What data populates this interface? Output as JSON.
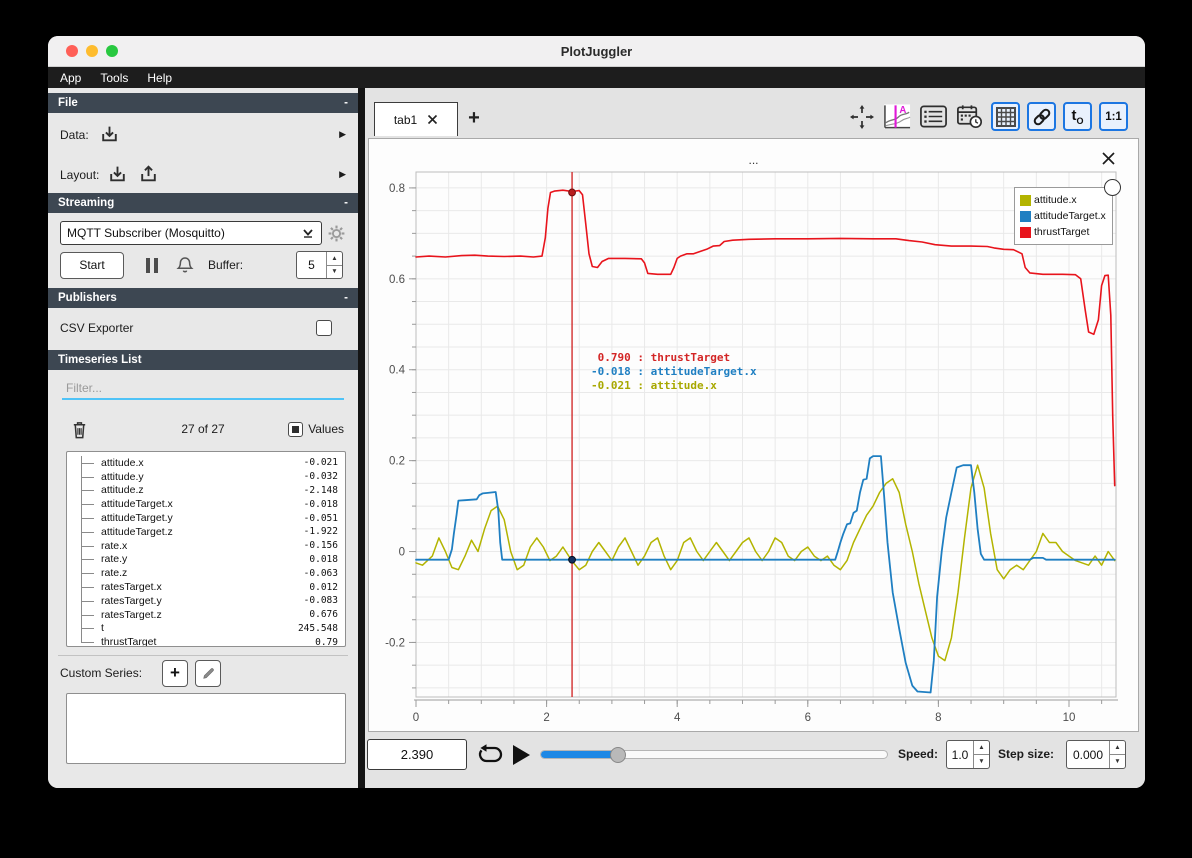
{
  "window": {
    "title": "PlotJuggler"
  },
  "menu": {
    "items": [
      "App",
      "Tools",
      "Help"
    ]
  },
  "sidebar": {
    "file": {
      "header": "File",
      "collapse": "-",
      "data_label": "Data:",
      "layout_label": "Layout:"
    },
    "streaming": {
      "header": "Streaming",
      "collapse": "-",
      "source": "MQTT Subscriber (Mosquitto)",
      "start_label": "Start",
      "buffer_label": "Buffer:",
      "buffer_value": "5"
    },
    "publishers": {
      "header": "Publishers",
      "collapse": "-",
      "csv_label": "CSV Exporter",
      "csv_checked": false
    },
    "timeseries": {
      "header": "Timeseries List",
      "filter_placeholder": "Filter...",
      "count": "27 of 27",
      "values_label": "Values",
      "values_checked": true,
      "items": [
        {
          "name": "attitude.x",
          "value": "-0.021"
        },
        {
          "name": "attitude.y",
          "value": "-0.032"
        },
        {
          "name": "attitude.z",
          "value": "-2.148"
        },
        {
          "name": "attitudeTarget.x",
          "value": "-0.018"
        },
        {
          "name": "attitudeTarget.y",
          "value": "-0.051"
        },
        {
          "name": "attitudeTarget.z",
          "value": "-1.922"
        },
        {
          "name": "rate.x",
          "value": "-0.156"
        },
        {
          "name": "rate.y",
          "value": "0.018"
        },
        {
          "name": "rate.z",
          "value": "-0.063"
        },
        {
          "name": "ratesTarget.x",
          "value": "0.012"
        },
        {
          "name": "ratesTarget.y",
          "value": "-0.083"
        },
        {
          "name": "ratesTarget.z",
          "value": "0.676"
        },
        {
          "name": "t",
          "value": "245.548"
        },
        {
          "name": "thrustTarget",
          "value": "0.79"
        }
      ],
      "custom_series_label": "Custom Series:"
    }
  },
  "main": {
    "tab_label": "tab1",
    "plot_title": "..."
  },
  "transport": {
    "time": "2.390",
    "slider_percent": 22.3,
    "speed_label": "Speed:",
    "speed": "1.0",
    "step_label": "Step size:",
    "step": "0.000"
  },
  "colors": {
    "accent_blue": "#1c76e2",
    "slider_blue": "#1e88e5",
    "filter_underline": "#4fc3f7",
    "header_bg": "#3d4752"
  },
  "chart_data": {
    "type": "line",
    "title": "...",
    "xlabel": "",
    "ylabel": "",
    "xlim": [
      0,
      10.72
    ],
    "ylim": [
      -0.32,
      0.835
    ],
    "x_ticks": [
      0,
      2,
      4,
      6,
      8,
      10
    ],
    "y_ticks": [
      -0.2,
      0,
      0.2,
      0.4,
      0.6,
      0.8
    ],
    "grid": {
      "on": true,
      "x_minor": 0.5,
      "y_minor": 0.05
    },
    "legend_position": "top-right",
    "series": [
      {
        "name": "attitude.x",
        "color": "#b3b400",
        "width": 1.5,
        "points": [
          [
            0,
            -0.025
          ],
          [
            0.1,
            -0.03
          ],
          [
            0.25,
            -0.01
          ],
          [
            0.35,
            0.03
          ],
          [
            0.45,
            0.0
          ],
          [
            0.55,
            -0.035
          ],
          [
            0.65,
            -0.04
          ],
          [
            0.75,
            -0.01
          ],
          [
            0.85,
            0.025
          ],
          [
            0.95,
            0.0
          ],
          [
            1.05,
            0.05
          ],
          [
            1.15,
            0.09
          ],
          [
            1.25,
            0.1
          ],
          [
            1.35,
            0.07
          ],
          [
            1.45,
            0.0
          ],
          [
            1.55,
            -0.04
          ],
          [
            1.65,
            -0.03
          ],
          [
            1.75,
            0.01
          ],
          [
            1.85,
            0.03
          ],
          [
            1.95,
            0.01
          ],
          [
            2.05,
            -0.02
          ],
          [
            2.15,
            -0.01
          ],
          [
            2.25,
            0.01
          ],
          [
            2.39,
            -0.021
          ],
          [
            2.5,
            -0.04
          ],
          [
            2.6,
            -0.03
          ],
          [
            2.7,
            0.0
          ],
          [
            2.8,
            0.02
          ],
          [
            2.9,
            0.0
          ],
          [
            3.0,
            -0.02
          ],
          [
            3.1,
            0.01
          ],
          [
            3.2,
            0.03
          ],
          [
            3.3,
            0.0
          ],
          [
            3.4,
            -0.03
          ],
          [
            3.5,
            -0.01
          ],
          [
            3.6,
            0.02
          ],
          [
            3.7,
            0.03
          ],
          [
            3.8,
            -0.01
          ],
          [
            3.9,
            -0.04
          ],
          [
            4.0,
            -0.02
          ],
          [
            4.1,
            0.02
          ],
          [
            4.2,
            0.03
          ],
          [
            4.3,
            0.0
          ],
          [
            4.4,
            -0.02
          ],
          [
            4.5,
            0.0
          ],
          [
            4.6,
            0.02
          ],
          [
            4.7,
            0.0
          ],
          [
            4.8,
            -0.02
          ],
          [
            4.9,
            0.0
          ],
          [
            5.0,
            0.02
          ],
          [
            5.1,
            0.03
          ],
          [
            5.2,
            0.0
          ],
          [
            5.3,
            -0.02
          ],
          [
            5.4,
            0.0
          ],
          [
            5.5,
            0.03
          ],
          [
            5.6,
            0.02
          ],
          [
            5.7,
            -0.01
          ],
          [
            5.8,
            -0.02
          ],
          [
            5.9,
            0.0
          ],
          [
            6.0,
            0.01
          ],
          [
            6.1,
            -0.01
          ],
          [
            6.2,
            -0.02
          ],
          [
            6.3,
            -0.01
          ],
          [
            6.4,
            -0.03
          ],
          [
            6.5,
            -0.04
          ],
          [
            6.6,
            -0.02
          ],
          [
            6.7,
            0.02
          ],
          [
            6.8,
            0.05
          ],
          [
            6.9,
            0.08
          ],
          [
            7.0,
            0.1
          ],
          [
            7.1,
            0.13
          ],
          [
            7.2,
            0.15
          ],
          [
            7.3,
            0.16
          ],
          [
            7.4,
            0.13
          ],
          [
            7.5,
            0.06
          ],
          [
            7.6,
            0.0
          ],
          [
            7.7,
            -0.07
          ],
          [
            7.8,
            -0.13
          ],
          [
            7.9,
            -0.19
          ],
          [
            8.0,
            -0.23
          ],
          [
            8.1,
            -0.24
          ],
          [
            8.2,
            -0.19
          ],
          [
            8.3,
            -0.09
          ],
          [
            8.4,
            0.03
          ],
          [
            8.5,
            0.14
          ],
          [
            8.6,
            0.19
          ],
          [
            8.7,
            0.14
          ],
          [
            8.8,
            0.04
          ],
          [
            8.9,
            -0.04
          ],
          [
            9.0,
            -0.06
          ],
          [
            9.1,
            -0.04
          ],
          [
            9.2,
            -0.03
          ],
          [
            9.3,
            -0.04
          ],
          [
            9.5,
            0.0
          ],
          [
            9.6,
            0.04
          ],
          [
            9.7,
            0.02
          ],
          [
            9.8,
            0.02
          ],
          [
            9.9,
            0.0
          ],
          [
            10.0,
            -0.01
          ],
          [
            10.1,
            -0.02
          ],
          [
            10.3,
            -0.03
          ],
          [
            10.4,
            -0.01
          ],
          [
            10.5,
            -0.03
          ],
          [
            10.6,
            0.0
          ],
          [
            10.7,
            -0.02
          ]
        ]
      },
      {
        "name": "attitudeTarget.x",
        "color": "#1f7fc2",
        "width": 1.8,
        "points": [
          [
            0,
            -0.018
          ],
          [
            0.5,
            -0.018
          ],
          [
            0.55,
            0.005
          ],
          [
            0.58,
            0.04
          ],
          [
            0.62,
            0.08
          ],
          [
            0.65,
            0.112
          ],
          [
            0.75,
            0.113
          ],
          [
            0.93,
            0.115
          ],
          [
            0.97,
            0.124
          ],
          [
            1.02,
            0.128
          ],
          [
            1.1,
            0.129
          ],
          [
            1.22,
            0.131
          ],
          [
            1.26,
            0.09
          ],
          [
            1.29,
            0.02
          ],
          [
            1.32,
            -0.018
          ],
          [
            2.0,
            -0.018
          ],
          [
            2.39,
            -0.018
          ],
          [
            3.0,
            -0.018
          ],
          [
            4.0,
            -0.018
          ],
          [
            5.0,
            -0.018
          ],
          [
            6.0,
            -0.018
          ],
          [
            6.42,
            -0.018
          ],
          [
            6.46,
            0.0
          ],
          [
            6.5,
            0.02
          ],
          [
            6.54,
            0.038
          ],
          [
            6.6,
            0.06
          ],
          [
            6.65,
            0.062
          ],
          [
            6.7,
            0.085
          ],
          [
            6.75,
            0.09
          ],
          [
            6.8,
            0.13
          ],
          [
            6.85,
            0.158
          ],
          [
            6.9,
            0.16
          ],
          [
            6.95,
            0.205
          ],
          [
            7.0,
            0.21
          ],
          [
            7.12,
            0.21
          ],
          [
            7.17,
            0.12
          ],
          [
            7.22,
            0.02
          ],
          [
            7.3,
            -0.09
          ],
          [
            7.4,
            -0.17
          ],
          [
            7.5,
            -0.245
          ],
          [
            7.6,
            -0.295
          ],
          [
            7.68,
            -0.308
          ],
          [
            7.88,
            -0.31
          ],
          [
            7.93,
            -0.24
          ],
          [
            7.98,
            -0.1
          ],
          [
            8.05,
            0.0
          ],
          [
            8.12,
            0.075
          ],
          [
            8.2,
            0.13
          ],
          [
            8.28,
            0.185
          ],
          [
            8.38,
            0.19
          ],
          [
            8.5,
            0.19
          ],
          [
            8.55,
            0.13
          ],
          [
            8.6,
            0.05
          ],
          [
            8.65,
            -0.005
          ],
          [
            8.7,
            -0.018
          ],
          [
            9.0,
            -0.018
          ],
          [
            9.4,
            -0.018
          ],
          [
            9.45,
            -0.014
          ],
          [
            9.6,
            -0.014
          ],
          [
            9.65,
            -0.018
          ],
          [
            10.0,
            -0.018
          ],
          [
            10.7,
            -0.018
          ]
        ]
      },
      {
        "name": "thrustTarget",
        "color": "#e8141c",
        "width": 1.6,
        "points": [
          [
            0,
            0.648
          ],
          [
            0.2,
            0.65
          ],
          [
            0.45,
            0.648
          ],
          [
            0.7,
            0.651
          ],
          [
            0.9,
            0.652
          ],
          [
            1.1,
            0.65
          ],
          [
            1.35,
            0.649
          ],
          [
            1.6,
            0.65
          ],
          [
            1.8,
            0.648
          ],
          [
            1.93,
            0.65
          ],
          [
            1.98,
            0.69
          ],
          [
            2.02,
            0.755
          ],
          [
            2.06,
            0.79
          ],
          [
            2.12,
            0.793
          ],
          [
            2.25,
            0.795
          ],
          [
            2.39,
            0.792
          ],
          [
            2.5,
            0.794
          ],
          [
            2.55,
            0.785
          ],
          [
            2.6,
            0.72
          ],
          [
            2.65,
            0.655
          ],
          [
            2.7,
            0.627
          ],
          [
            2.78,
            0.625
          ],
          [
            2.85,
            0.638
          ],
          [
            2.95,
            0.645
          ],
          [
            3.2,
            0.645
          ],
          [
            3.45,
            0.644
          ],
          [
            3.5,
            0.635
          ],
          [
            3.55,
            0.612
          ],
          [
            3.7,
            0.61
          ],
          [
            3.9,
            0.61
          ],
          [
            3.95,
            0.625
          ],
          [
            4.0,
            0.645
          ],
          [
            4.05,
            0.65
          ],
          [
            4.15,
            0.655
          ],
          [
            4.25,
            0.655
          ],
          [
            4.35,
            0.66
          ],
          [
            4.45,
            0.665
          ],
          [
            4.55,
            0.672
          ],
          [
            4.65,
            0.673
          ],
          [
            4.72,
            0.682
          ],
          [
            4.85,
            0.685
          ],
          [
            5.1,
            0.687
          ],
          [
            5.5,
            0.688
          ],
          [
            6.0,
            0.688
          ],
          [
            6.5,
            0.689
          ],
          [
            7.0,
            0.688
          ],
          [
            7.35,
            0.688
          ],
          [
            7.55,
            0.684
          ],
          [
            7.75,
            0.681
          ],
          [
            7.95,
            0.675
          ],
          [
            8.2,
            0.672
          ],
          [
            8.5,
            0.672
          ],
          [
            8.75,
            0.671
          ],
          [
            8.85,
            0.668
          ],
          [
            9.0,
            0.665
          ],
          [
            9.15,
            0.664
          ],
          [
            9.28,
            0.655
          ],
          [
            9.33,
            0.625
          ],
          [
            9.4,
            0.613
          ],
          [
            9.6,
            0.61
          ],
          [
            9.9,
            0.61
          ],
          [
            10.1,
            0.609
          ],
          [
            10.18,
            0.6
          ],
          [
            10.25,
            0.53
          ],
          [
            10.3,
            0.483
          ],
          [
            10.38,
            0.478
          ],
          [
            10.45,
            0.51
          ],
          [
            10.5,
            0.585
          ],
          [
            10.55,
            0.607
          ],
          [
            10.6,
            0.608
          ],
          [
            10.64,
            0.52
          ],
          [
            10.67,
            0.3
          ],
          [
            10.7,
            0.145
          ]
        ]
      }
    ],
    "tracker": {
      "x": 2.39,
      "line_color": "#cf1f1f",
      "dots": [
        {
          "y": 0.79,
          "fill": "#b71c1c",
          "stroke": "#6d0d0d"
        },
        {
          "y": -0.018,
          "fill": "#12315f",
          "stroke": "#050e1c"
        }
      ],
      "readouts": [
        {
          "value": " 0.790",
          "series": "thrustTarget",
          "color": "#d32525"
        },
        {
          "value": "-0.018",
          "series": "attitudeTarget.x",
          "color": "#1f7fc2"
        },
        {
          "value": "-0.021",
          "series": "attitude.x",
          "color": "#a8a800"
        }
      ]
    }
  }
}
